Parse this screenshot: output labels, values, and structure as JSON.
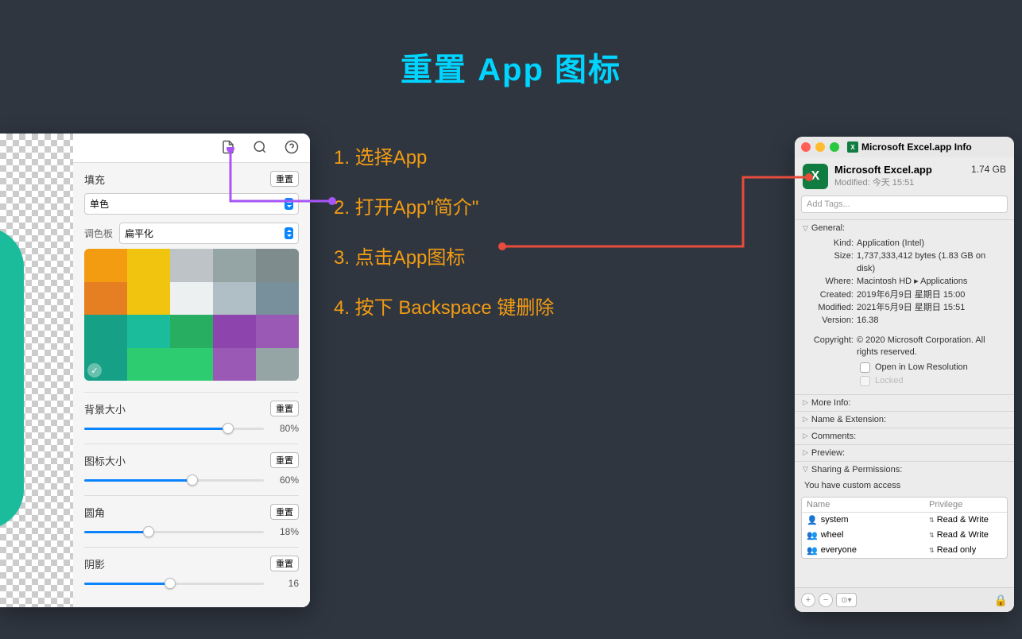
{
  "title": "重置 App 图标",
  "steps": [
    "1. 选择App",
    "2. 打开App\"简介\"",
    "3. 点击App图标",
    "4. 按下 Backspace 键删除"
  ],
  "leftPanel": {
    "fillLabel": "填充",
    "resetLabel": "重置",
    "colorMode": "单色",
    "paletteLabel": "调色板",
    "paletteStyle": "扁平化",
    "swatches": [
      "#f39c12",
      "#f1c40f",
      "#bdc3c7",
      "#95a5a6",
      "#7f8c8d",
      "#e67e22",
      "#f1c40f",
      "#ecf0f1",
      "#b0bec5",
      "#78909c",
      "#16a085",
      "#1abc9c",
      "#27ae60",
      "#8e44ad",
      "#9b59b6",
      "#16a085",
      "#2ecc71",
      "#2ecc71",
      "#9b59b6",
      "#95a5a6"
    ],
    "selectedSwatch": 15,
    "sliders": [
      {
        "label": "背景大小",
        "value": "80%",
        "pct": 80
      },
      {
        "label": "图标大小",
        "value": "60%",
        "pct": 60
      },
      {
        "label": "圆角",
        "value": "18%",
        "pct": 36
      },
      {
        "label": "阴影",
        "value": "16",
        "pct": 48
      }
    ]
  },
  "infoWindow": {
    "windowTitle": "Microsoft Excel.app Info",
    "appName": "Microsoft Excel.app",
    "appSize": "1.74 GB",
    "modified": "Modified: 今天 15:51",
    "tagsPlaceholder": "Add Tags...",
    "general": {
      "header": "General:",
      "kind": {
        "k": "Kind:",
        "v": "Application (Intel)"
      },
      "size": {
        "k": "Size:",
        "v": "1,737,333,412 bytes (1.83 GB on disk)"
      },
      "where": {
        "k": "Where:",
        "v": "Macintosh HD ▸ Applications"
      },
      "created": {
        "k": "Created:",
        "v": "2019年6月9日 星期日 15:00"
      },
      "modified": {
        "k": "Modified:",
        "v": "2021年5月9日 星期日 15:51"
      },
      "version": {
        "k": "Version:",
        "v": "16.38"
      },
      "copyright": {
        "k": "Copyright:",
        "v": "© 2020 Microsoft Corporation. All rights reserved."
      },
      "openLowRes": "Open in Low Resolution",
      "locked": "Locked"
    },
    "sections": {
      "moreInfo": "More Info:",
      "nameExt": "Name & Extension:",
      "comments": "Comments:",
      "preview": "Preview:",
      "sharing": "Sharing & Permissions:"
    },
    "permText": "You have custom access",
    "permHeaders": {
      "name": "Name",
      "priv": "Privilege"
    },
    "permRows": [
      {
        "icon": "single",
        "name": "system",
        "priv": "Read & Write"
      },
      {
        "icon": "group",
        "name": "wheel",
        "priv": "Read & Write"
      },
      {
        "icon": "group",
        "name": "everyone",
        "priv": "Read only"
      }
    ]
  }
}
